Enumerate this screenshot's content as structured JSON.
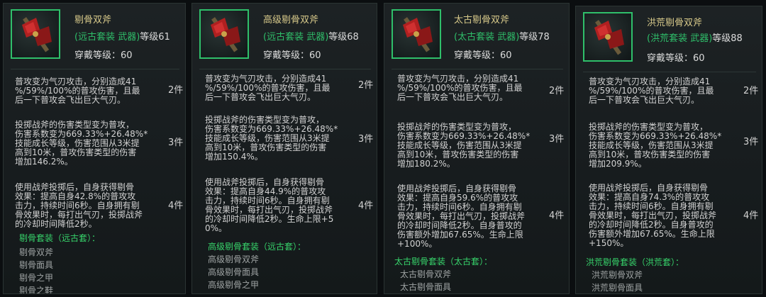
{
  "cards": [
    {
      "title": "剔骨双斧",
      "series": "(远古套装 武器)",
      "level": "等级61",
      "wear": "穿戴等级：60",
      "effects": [
        {
          "text": "普攻变为气刃攻击，分别造成41\n%/59%/100%的普攻伤害，且最\n后一下普攻会飞出巨大气刃。",
          "count": "2件"
        },
        {
          "text": "投掷战斧的伤害类型变为普攻，\n伤害系数变为669.33%+26.48%*\n技能成长等级，伤害范围从3米提\n高到10米，普攻伤害类型的伤害\n增加146.2%。",
          "count": "3件"
        },
        {
          "text": "使用战斧投掷后，自身获得剔骨\n效果：提高自身42.8%的普攻攻\n击力，持续时间6秒。自身拥有剔\n骨效果时，每打出气刃，投掷战斧\n的冷却时间降低2秒。",
          "count": "4件"
        }
      ],
      "set_title": "剔骨套装（远古套）：",
      "set_items": [
        "剔骨双斧",
        "剔骨面具",
        "剔骨之甲",
        "剔骨之鞋"
      ]
    },
    {
      "title": "高级剔骨双斧",
      "series": "(远古套装 武器)",
      "level": "等级68",
      "wear": "穿戴等级：60",
      "effects": [
        {
          "text": "普攻变为气刃攻击，分别造成41\n%/59%/100%的普攻伤害，且最\n后一下普攻会飞出巨大气刃。",
          "count": "2件"
        },
        {
          "text": "投掷战斧的伤害类型变为普攻，\n伤害系数变为669.33%+26.48%*\n技能成长等级，伤害范围从3米提\n高到10米，普攻伤害类型的伤害\n增加150.4%。",
          "count": "3件"
        },
        {
          "text": "使用战斧投掷后，自身获得剔骨\n效果：提高自身44.9%的普攻攻\n击力，持续时间6秒。自身拥有剔\n骨效果时，每打出气刃，投掷战斧\n的冷却时间降低2秒。生命上限+5\n0%。",
          "count": "4件"
        }
      ],
      "set_title": "高级剔骨套装（远古套）：",
      "set_items": [
        "高级剔骨双斧",
        "高级剔骨面具",
        "高级剔骨之甲"
      ]
    },
    {
      "title": "太古剔骨双斧",
      "series": "(太古套装 武器)",
      "level": "等级78",
      "wear": "穿戴等级：60",
      "effects": [
        {
          "text": "普攻变为气刃攻击，分别造成41\n%/59%/100%的普攻伤害，且最\n后一下普攻会飞出巨大气刃。",
          "count": "2件"
        },
        {
          "text": "投掷战斧的伤害类型变为普攻，\n伤害系数变为669.33%+26.48%*\n技能成长等级，伤害范围从3米提\n高到10米，普攻伤害类型的伤害\n增加180.2%。",
          "count": "3件"
        },
        {
          "text": "使用战斧投掷后，自身获得剔骨\n效果：提高自身59.6%的普攻攻\n击力，持续时间6秒。自身拥有剔\n骨效果时，每打出气刃，投掷战斧\n的冷却时间降低2秒。自身普攻的\n伤害额外增加67.65%。生命上限\n+100%。",
          "count": "4件"
        }
      ],
      "set_title": "太古剔骨套装（太古套）：",
      "set_items": [
        "太古剔骨双斧",
        "太古剔骨面具"
      ]
    },
    {
      "title": "洪荒剔骨双斧",
      "series": "(洪荒套装 武器)",
      "level": "等级88",
      "wear": "穿戴等级：60",
      "effects": [
        {
          "text": "普攻变为气刃攻击，分别造成41\n%/59%/100%的普攻伤害，且最\n后一下普攻会飞出巨大气刃。",
          "count": "2件"
        },
        {
          "text": "投掷战斧的伤害类型变为普攻，\n伤害系数变为669.33%+26.48%*\n技能成长等级，伤害范围从3米提\n高到10米，普攻伤害类型的伤害\n增加209.9%。",
          "count": "3件"
        },
        {
          "text": "使用战斧投掷后，自身获得剔骨\n效果：提高自身74.3%的普攻攻\n击力，持续时间6秒。自身拥有剔\n骨效果时，每打出气刃，投掷战斧\n的冷却时间降低2秒。自身普攻的\n伤害额外增加67.65%。生命上限\n+150%。",
          "count": "4件"
        }
      ],
      "set_title": "洪荒剔骨套装（洪荒套）：",
      "set_items": [
        "洪荒剔骨双斧",
        "洪荒剔骨面具"
      ]
    }
  ],
  "colors": {
    "series_green": "#2fbf6a",
    "set_green": "#37d46b",
    "title_gold": "#d7c98a"
  },
  "icons": [
    "double-axe-icon"
  ]
}
